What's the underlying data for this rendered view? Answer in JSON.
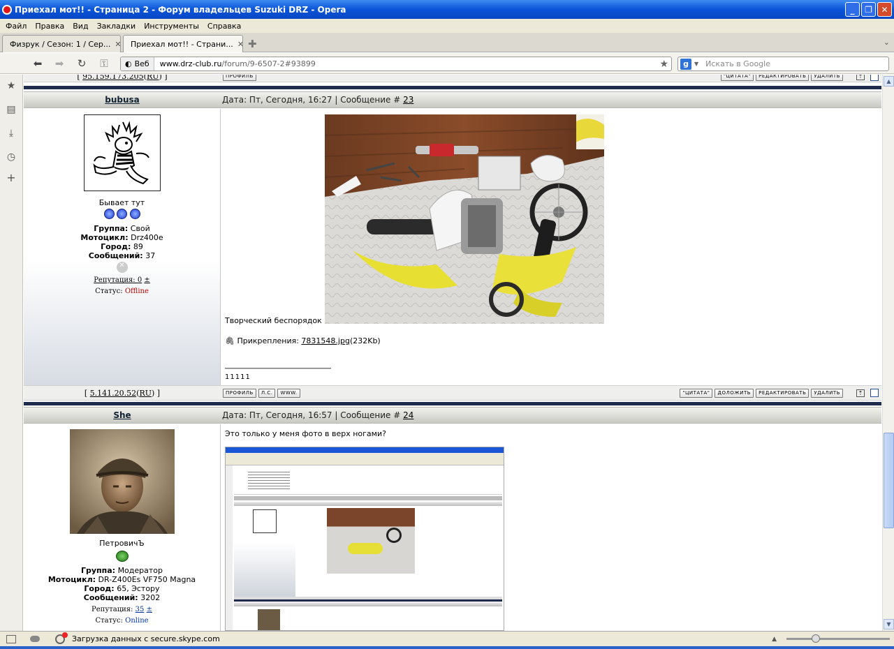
{
  "window": {
    "title": "Приехал мот!! - Страница 2 - Форум владельцев Suzuki DRZ - Opera"
  },
  "menu": [
    "Файл",
    "Правка",
    "Вид",
    "Закладки",
    "Инструменты",
    "Справка"
  ],
  "tabs": [
    {
      "label": "Физрук / Сезон: 1 / Сер..."
    },
    {
      "label": "Приехал мот!! - Страни..."
    }
  ],
  "nav": {
    "web_label": "Веб",
    "url_host": "www.drz-club.ru",
    "url_path": "/forum/9-6507-2#93899",
    "search_placeholder": "Искать в Google"
  },
  "top_row": {
    "ip": "95.159.173.205",
    "country": "RU"
  },
  "buttons": {
    "profile": "ПРОФИЛЬ",
    "pm": "Л.С.",
    "www": "WWW.",
    "quote": "ЦИТАТА",
    "reply": "ДОЛОЖИТЬ",
    "edit": "РЕДАКТИРОВАТЬ",
    "delete": "УДАЛИТЬ"
  },
  "post23": {
    "nick": "bubusa",
    "date_prefix": "Дата: Пт, Сегодня, 16:27 | Сообщение #",
    "number": "23",
    "rank": "Бывает тут",
    "group_label": "Группа:",
    "group": "Свой",
    "moto_label": "Мотоцикл:",
    "moto": "Drz400e",
    "city_label": "Город:",
    "city": "89",
    "msgs_label": "Сообщений:",
    "msgs": "37",
    "rep_label": "Репутация: 0",
    "rep_pm": "±",
    "status_label": "Статус:",
    "status": "Offline",
    "text": "Творческий беспорядок",
    "attach_label": "Прикрепления:",
    "attach_file": "7831548.jpg",
    "attach_size": "(232Kb)",
    "signature": "11111",
    "ip": "5.141.20.52",
    "country": "RU"
  },
  "post24": {
    "nick": "She",
    "date_prefix": "Дата: Пт, Сегодня, 16:57 | Сообщение #",
    "number": "24",
    "rank": "ПетровичЪ",
    "group_label": "Группа:",
    "group": "Модератор",
    "moto_label": "Мотоцикл:",
    "moto": "DR-Z400Es VF750 Magna",
    "city_label": "Город:",
    "city": "65, Эстору",
    "msgs_label": "Сообщений:",
    "msgs": "3202",
    "rep_label": "Репутация:",
    "rep_value": "35",
    "rep_pm": "±",
    "status_label": "Статус:",
    "status": "Online",
    "text": "Это только у меня фото  в верх ногами?"
  },
  "status": {
    "text": "Загрузка данных с secure.skype.com"
  },
  "colors": {
    "titlebar": "#0a54d8",
    "offline": "#c00000",
    "online": "#0033aa",
    "divider": "#1e2b4c"
  }
}
